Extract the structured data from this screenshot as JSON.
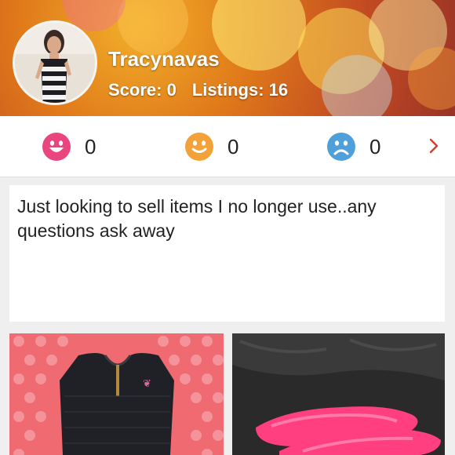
{
  "profile": {
    "username": "Tracynavas",
    "score_label": "Score:",
    "score_value": "0",
    "listings_label": "Listings:",
    "listings_value": "16"
  },
  "ratings": [
    {
      "icon": "happy-face-icon",
      "count": "0",
      "color": "#e9457f"
    },
    {
      "icon": "neutral-face-icon",
      "count": "0",
      "color": "#f3a23a"
    },
    {
      "icon": "sad-face-icon",
      "count": "0",
      "color": "#4f9fdb"
    }
  ],
  "nav": {
    "next_icon": "chevron-right-icon",
    "accent": "#d93b30"
  },
  "bio": {
    "text": "Just looking to sell items I no longer use..any questions ask away"
  },
  "listings": [
    {
      "name": "black dress listing",
      "image": "black-dress-photo"
    },
    {
      "name": "pink flats listing",
      "image": "pink-shoes-photo"
    }
  ]
}
